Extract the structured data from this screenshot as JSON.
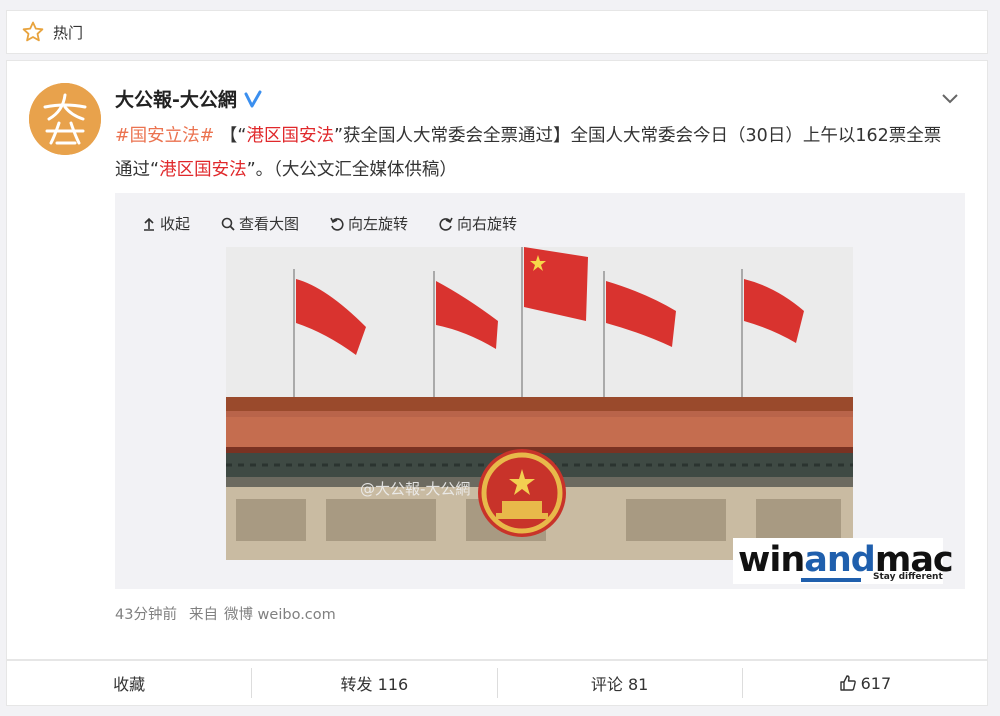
{
  "header": {
    "hot_label": "热门"
  },
  "post": {
    "author": "大公報-大公網",
    "hashtag": "#国安立法#",
    "bracket_open": "【“",
    "keyword": "港区国安法",
    "text_a": "”获全国人大常委会全票通过】全国人大常委会今日（30日）上午以162票全票通过“",
    "keyword2": "港区国安法",
    "text_b": "”。（大公文汇全媒体供稿）",
    "time": "43分钟前",
    "source_prefix": "来自",
    "source": "微博 weibo.com"
  },
  "media": {
    "collapse_label": "收起",
    "view_large_label": "查看大图",
    "rotate_left_label": "向左旋转",
    "rotate_right_label": "向右旋转",
    "watermark": "@大公報-大公網"
  },
  "brand": {
    "name_a": "win",
    "name_b": "and",
    "name_c": "mac",
    "tagline": "Stay different"
  },
  "actions": {
    "favorite_label": "收藏",
    "repost_label": "转发 116",
    "comment_label": "评论 81",
    "like_count": "617"
  },
  "icons": [
    "star-icon",
    "avatar-logo",
    "verified-icon",
    "chevron-down-icon",
    "collapse-icon",
    "search-icon",
    "rotate-left-icon",
    "rotate-right-icon",
    "thumbs-up-icon"
  ],
  "colors": {
    "accent": "#eb7350",
    "keyword": "#e0282b",
    "verified": "#3b8fef"
  }
}
